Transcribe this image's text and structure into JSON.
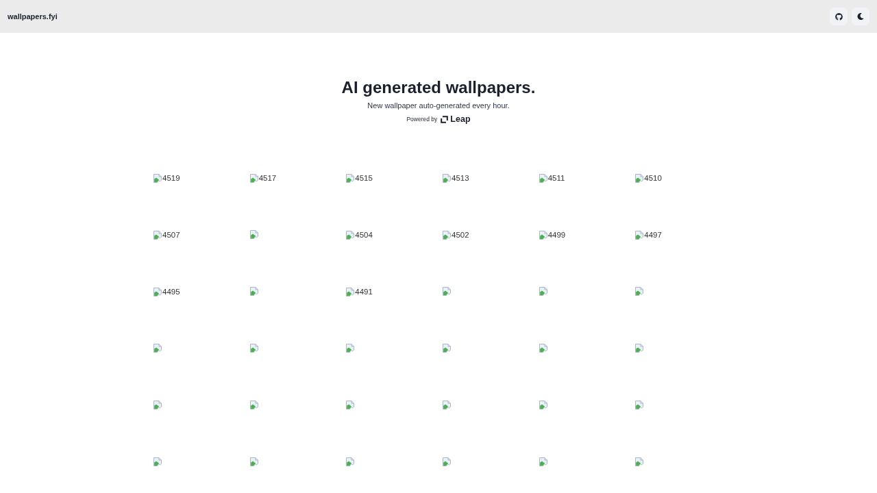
{
  "header": {
    "logo": "wallpapers.fyi"
  },
  "hero": {
    "title": "AI generated wallpapers.",
    "subtitle": "New wallpaper auto-generated every hour.",
    "powered_by": "Powered by",
    "brand": "Leap"
  },
  "wallpapers": [
    {
      "kind": "image",
      "alt": "4519"
    },
    {
      "kind": "image",
      "alt": "4517"
    },
    {
      "kind": "image",
      "alt": "4515"
    },
    {
      "kind": "image",
      "alt": "4513"
    },
    {
      "kind": "image",
      "alt": "4511"
    },
    {
      "kind": "image",
      "alt": "4510"
    },
    {
      "kind": "image",
      "alt": "4507"
    },
    {
      "kind": "image"
    },
    {
      "kind": "image",
      "alt": "4504"
    },
    {
      "kind": "image",
      "alt": "4502"
    },
    {
      "kind": "image",
      "alt": "4499"
    },
    {
      "kind": "image",
      "alt": "4497"
    },
    {
      "kind": "image",
      "alt": "4495"
    },
    {
      "kind": "image"
    },
    {
      "kind": "image",
      "alt": "4491"
    },
    {
      "kind": "image"
    },
    {
      "kind": "image"
    },
    {
      "kind": "image"
    },
    {
      "kind": "image"
    },
    {
      "kind": "image"
    },
    {
      "kind": "image"
    },
    {
      "kind": "image"
    },
    {
      "kind": "image"
    },
    {
      "kind": "image"
    },
    {
      "kind": "image"
    },
    {
      "kind": "image"
    },
    {
      "kind": "image"
    },
    {
      "kind": "image"
    },
    {
      "kind": "image"
    },
    {
      "kind": "image"
    },
    {
      "kind": "image"
    },
    {
      "kind": "image"
    },
    {
      "kind": "image"
    },
    {
      "kind": "image"
    },
    {
      "kind": "image"
    },
    {
      "kind": "image"
    }
  ]
}
